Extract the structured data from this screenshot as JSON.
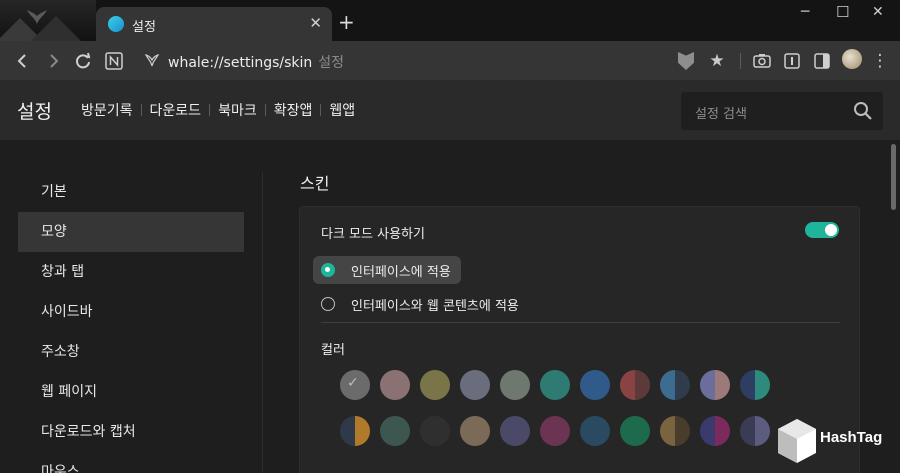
{
  "browser": {
    "tab_title": "설정",
    "url": "whale://settings/skin",
    "url_hint": "설정"
  },
  "header": {
    "title": "설정",
    "nav": [
      "방문기록",
      "다운로드",
      "북마크",
      "확장앱",
      "웹앱"
    ],
    "search_placeholder": "설정 검색"
  },
  "sidebar": {
    "items": [
      "기본",
      "모양",
      "창과 탭",
      "사이드바",
      "주소창",
      "웹 페이지",
      "다운로드와 캡처",
      "마우스"
    ],
    "active_index": 1
  },
  "skin": {
    "section_title": "스킨",
    "dark_mode_label": "다크 모드 사용하기",
    "dark_mode_enabled": true,
    "options": [
      "인터페이스에 적용",
      "인터페이스와 웹 콘텐츠에 적용"
    ],
    "selected_option": 0,
    "color_label": "컬러",
    "colors_row1": [
      [
        "#6b6b6b"
      ],
      [
        "#8a7272"
      ],
      [
        "#7a7548"
      ],
      [
        "#6a6d7c"
      ],
      [
        "#6f786f"
      ],
      [
        "#2d7b73"
      ],
      [
        "#2f5a8a"
      ],
      [
        "#8a4343",
        "#5c3a3a"
      ],
      [
        "#3c6c90",
        "#303c4c"
      ],
      [
        "#6b6e9a",
        "#9c7a7a"
      ],
      [
        "#2d3e62",
        "#2e8a7c"
      ]
    ],
    "colors_row2": [
      [
        "#2e3a4a",
        "#b07a2a"
      ],
      [
        "#3e5650"
      ],
      [
        "#2f2f2f"
      ],
      [
        "#7c6a58"
      ],
      [
        "#4a4a68"
      ],
      [
        "#6a3452"
      ],
      [
        "#2a4a62"
      ],
      [
        "#1e6a4c"
      ],
      [
        "#7a6440",
        "#4a3c2a"
      ],
      [
        "#3a3a6c",
        "#7c2a5c"
      ],
      [
        "#3a3c56",
        "#5c5c80"
      ]
    ],
    "selected_color": "0"
  },
  "watermark": "HashTag",
  "accent_color": "#1fb59a"
}
